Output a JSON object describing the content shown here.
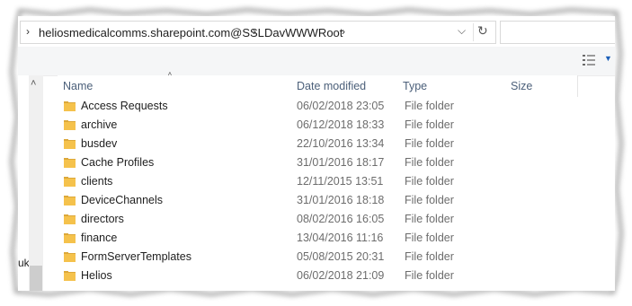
{
  "address": {
    "segments": [
      "heliosmedicalcomms.sharepoint.com@SSL",
      "DavWWWRoot"
    ],
    "dropdown_icon": "chevron-down-icon",
    "refresh_icon": "refresh-icon"
  },
  "search": {
    "placeholder": ""
  },
  "toolbar": {
    "view_icon": "details-view-icon"
  },
  "nav": {
    "peek_text": "uk"
  },
  "columns": {
    "name": "Name",
    "date": "Date modified",
    "type": "Type",
    "size": "Size"
  },
  "files": [
    {
      "name": "Access Requests",
      "date": "06/02/2018 23:05",
      "type": "File folder"
    },
    {
      "name": "archive",
      "date": "06/12/2018 18:33",
      "type": "File folder"
    },
    {
      "name": "busdev",
      "date": "22/10/2016 13:34",
      "type": "File folder"
    },
    {
      "name": "Cache Profiles",
      "date": "31/01/2016 18:17",
      "type": "File folder"
    },
    {
      "name": "clients",
      "date": "12/11/2015 13:51",
      "type": "File folder"
    },
    {
      "name": "DeviceChannels",
      "date": "31/01/2016 18:18",
      "type": "File folder"
    },
    {
      "name": "directors",
      "date": "08/02/2016 16:05",
      "type": "File folder"
    },
    {
      "name": "finance",
      "date": "13/04/2016 11:16",
      "type": "File folder"
    },
    {
      "name": "FormServerTemplates",
      "date": "05/08/2015 20:31",
      "type": "File folder"
    },
    {
      "name": "Helios",
      "date": "06/02/2018 21:09",
      "type": "File folder"
    }
  ],
  "colors": {
    "folder": "#f5c24c",
    "folder_dark": "#dca83a",
    "header_text": "#4c607a"
  }
}
